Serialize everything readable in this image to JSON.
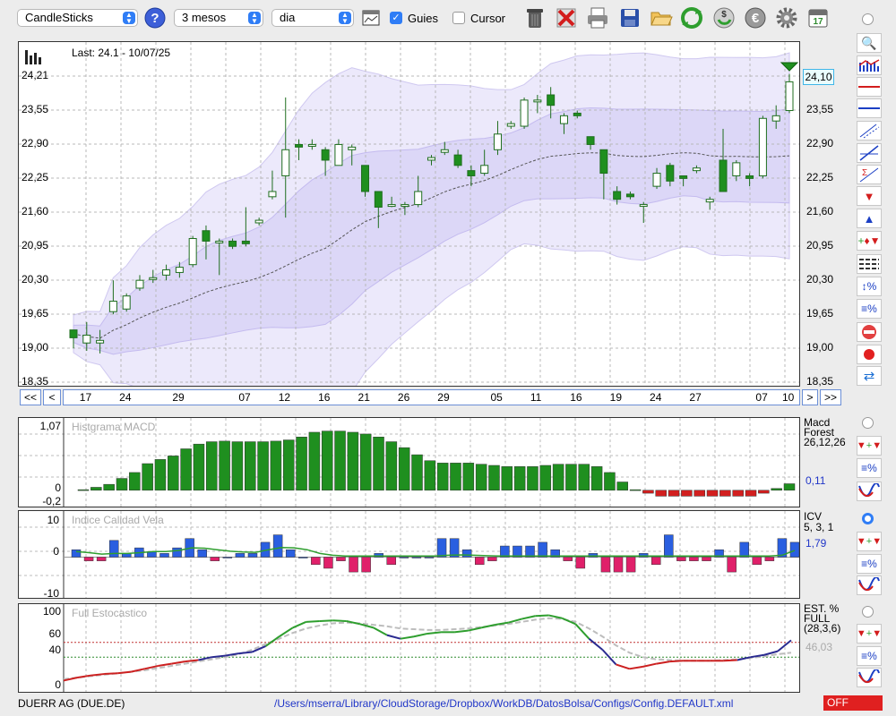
{
  "toolbar": {
    "chart_type": "CandleSticks",
    "period": "3 mesos",
    "interval": "dia",
    "guides_label": "Guies",
    "cursor_label": "Cursor",
    "guides_checked": true,
    "cursor_checked": false
  },
  "main": {
    "last_label": "Last: 24.1 - 10/07/25",
    "current_price": "24,10",
    "y_ticks": [
      "24,21",
      "23,55",
      "22,90",
      "22,25",
      "21,60",
      "20,95",
      "20,30",
      "19,65",
      "19,00",
      "18,35"
    ],
    "x_ticks": [
      "17",
      "24",
      "29",
      "07",
      "12",
      "16",
      "21",
      "26",
      "29",
      "05",
      "11",
      "16",
      "19",
      "24",
      "27",
      "07",
      "10"
    ],
    "nav": {
      "first": "<<",
      "prev": "<",
      "next": ">",
      "last": ">>"
    }
  },
  "macd": {
    "title": "Histgrama MACD",
    "name": "Macd",
    "name2": "Forest",
    "params": "26,12,26",
    "value": "0,11",
    "y_ticks": [
      "1,07",
      "0",
      "-0,2"
    ]
  },
  "icv": {
    "title": "Indice Calidad Vela",
    "name": "ICV",
    "params": "5, 3, 1",
    "value": "1,79",
    "y_ticks": [
      "10",
      "0",
      "-10"
    ]
  },
  "stoch": {
    "title": "Full Estocastico",
    "name": "EST. %",
    "name2": "FULL",
    "params": "(28,3,6)",
    "value": "46,03",
    "y_ticks": [
      "100",
      "60",
      "40",
      "0"
    ]
  },
  "status": {
    "instrument": "DUERR AG (DUE.DE)",
    "path": "/Users/mserra/Library/CloudStorage/Dropbox/WorkDB/DatosBolsa/Configs/Config.DEFAULT.xml",
    "off_label": "OFF"
  },
  "colors": {
    "up": "#ffffff",
    "down": "#1f8f1f",
    "macd_pos": "#1f8f1f",
    "macd_neg": "#d21f1f",
    "icv_pos": "#2a5fe0",
    "icv_neg": "#e0206a",
    "band": "#dcd7f7",
    "off": "#e02020"
  },
  "chart_data": [
    {
      "type": "candlestick",
      "ylim": [
        18.35,
        24.21
      ],
      "candles": [
        [
          19.35,
          19.2,
          19.35,
          19.0
        ],
        [
          19.1,
          19.25,
          19.5,
          18.95
        ],
        [
          19.1,
          19.15,
          19.35,
          18.9
        ],
        [
          19.7,
          19.9,
          20.3,
          19.65
        ],
        [
          19.75,
          20.0,
          20.05,
          19.7
        ],
        [
          20.15,
          20.3,
          20.4,
          20.1
        ],
        [
          20.35,
          20.35,
          20.5,
          20.25
        ],
        [
          20.4,
          20.5,
          20.6,
          20.3
        ],
        [
          20.45,
          20.55,
          20.65,
          20.35
        ],
        [
          20.6,
          21.1,
          21.15,
          20.55
        ],
        [
          21.25,
          21.05,
          21.35,
          20.7
        ],
        [
          21.05,
          21.05,
          21.1,
          20.4
        ],
        [
          21.05,
          20.95,
          21.1,
          20.9
        ],
        [
          21.05,
          21.0,
          21.7,
          20.95
        ],
        [
          21.4,
          21.45,
          21.5,
          21.35
        ],
        [
          21.9,
          22.0,
          22.4,
          21.85
        ],
        [
          22.3,
          22.8,
          23.8,
          21.5
        ],
        [
          22.9,
          22.85,
          23.0,
          22.6
        ],
        [
          22.9,
          22.9,
          23.0,
          22.8
        ],
        [
          22.8,
          22.6,
          22.85,
          22.3
        ],
        [
          22.5,
          22.9,
          23.0,
          22.5
        ],
        [
          22.8,
          22.85,
          22.9,
          22.5
        ],
        [
          22.5,
          22.0,
          22.5,
          21.9
        ],
        [
          22.0,
          21.7,
          22.0,
          21.3
        ],
        [
          21.75,
          21.75,
          21.9,
          21.7
        ],
        [
          21.75,
          21.75,
          21.8,
          21.55
        ],
        [
          21.75,
          22.0,
          22.3,
          21.7
        ],
        [
          22.6,
          22.65,
          22.7,
          22.5
        ],
        [
          22.75,
          22.8,
          22.95,
          22.7
        ],
        [
          22.7,
          22.5,
          22.8,
          22.45
        ],
        [
          22.4,
          22.3,
          22.5,
          22.1
        ],
        [
          22.35,
          22.5,
          22.8,
          22.3
        ],
        [
          22.8,
          23.1,
          23.35,
          22.7
        ],
        [
          23.25,
          23.3,
          23.35,
          23.2
        ],
        [
          23.25,
          23.75,
          23.8,
          23.2
        ],
        [
          23.75,
          23.75,
          23.85,
          23.5
        ],
        [
          23.85,
          23.65,
          24.0,
          23.4
        ],
        [
          23.3,
          23.45,
          23.5,
          23.1
        ],
        [
          23.5,
          23.45,
          23.55,
          23.4
        ],
        [
          23.05,
          22.9,
          23.05,
          22.8
        ],
        [
          22.8,
          22.35,
          22.8,
          21.85
        ],
        [
          22.0,
          21.85,
          22.1,
          21.75
        ],
        [
          21.95,
          21.9,
          22.0,
          21.85
        ],
        [
          21.75,
          21.75,
          21.8,
          21.4
        ],
        [
          22.1,
          22.35,
          22.45,
          22.05
        ],
        [
          22.5,
          22.2,
          22.55,
          22.1
        ],
        [
          22.3,
          22.25,
          22.3,
          22.1
        ],
        [
          22.4,
          22.45,
          22.5,
          22.35
        ],
        [
          21.8,
          21.85,
          21.9,
          21.65
        ],
        [
          22.6,
          22.0,
          23.2,
          22.0
        ],
        [
          22.3,
          22.55,
          22.6,
          22.2
        ],
        [
          22.3,
          22.25,
          22.35,
          22.1
        ],
        [
          22.3,
          23.4,
          23.45,
          22.25
        ],
        [
          23.35,
          23.45,
          23.65,
          23.2
        ],
        [
          23.55,
          24.1,
          24.25,
          23.5
        ]
      ]
    },
    {
      "type": "bar",
      "name": "MACD Forest",
      "ylim": [
        -0.2,
        1.07
      ],
      "values": [
        0.01,
        0.05,
        0.1,
        0.2,
        0.3,
        0.45,
        0.52,
        0.58,
        0.7,
        0.78,
        0.82,
        0.83,
        0.82,
        0.82,
        0.82,
        0.83,
        0.85,
        0.9,
        0.98,
        1.0,
        1.0,
        0.98,
        0.95,
        0.9,
        0.82,
        0.72,
        0.6,
        0.5,
        0.46,
        0.46,
        0.46,
        0.44,
        0.42,
        0.4,
        0.4,
        0.4,
        0.42,
        0.44,
        0.44,
        0.44,
        0.4,
        0.3,
        0.14,
        0.01,
        -0.05,
        -0.1,
        -0.1,
        -0.1,
        -0.1,
        -0.1,
        -0.1,
        -0.1,
        -0.1,
        -0.05,
        0.03,
        0.11
      ]
    },
    {
      "type": "bar",
      "name": "ICV",
      "ylim": [
        -10,
        10
      ],
      "values": [
        2,
        -1,
        -1,
        4.5,
        1,
        2.5,
        1.5,
        1,
        2.5,
        5,
        2,
        -1,
        0,
        1,
        1,
        4,
        6,
        2,
        0,
        -2,
        -3,
        -1,
        -4,
        -4,
        1,
        -2,
        0,
        0,
        0,
        5,
        5,
        2,
        -2,
        -1,
        3,
        3,
        3,
        4,
        2,
        -1,
        -3,
        1,
        -4,
        -4,
        -4,
        1,
        -2,
        6,
        -1,
        -1,
        -1,
        2,
        -4,
        4,
        -2,
        -1,
        5,
        4
      ],
      "line": [
        1.5,
        1.2,
        0.8,
        1,
        1,
        1.2,
        1.5,
        1.5,
        1.8,
        2.5,
        2.4,
        2,
        1.6,
        1.4,
        1.3,
        2,
        2.6,
        2.5,
        2,
        1,
        0.5,
        0.3,
        0.3,
        0.3,
        0.3,
        0.3,
        0.3,
        0.3,
        0.3,
        0.5,
        0.6,
        0.5,
        0.4,
        0.3,
        0.3,
        0.3,
        0.3,
        0.3,
        0.3,
        0.3,
        0.3,
        0.3,
        0.3,
        0.3,
        0.3,
        0.3,
        0.3,
        0.3,
        0.3,
        0.3,
        0.3,
        0.3,
        0.3,
        0.3,
        0.3,
        0.5,
        1.79
      ]
    },
    {
      "type": "line",
      "name": "Full Estocastico",
      "ylim": [
        0,
        100
      ],
      "levels": [
        60,
        40
      ],
      "k": [
        8,
        12,
        15,
        17,
        18,
        20,
        24,
        28,
        31,
        34,
        36,
        40,
        42,
        45,
        47,
        55,
        68,
        80,
        88,
        89,
        90,
        89,
        85,
        80,
        70,
        65,
        68,
        72,
        74,
        74,
        76,
        80,
        84,
        87,
        92,
        96,
        97,
        93,
        85,
        65,
        50,
        30,
        24,
        27,
        31,
        34,
        35,
        35,
        35,
        35,
        36,
        40,
        43,
        48,
        63
      ],
      "d": [
        10,
        12,
        14,
        16,
        18,
        20,
        22,
        25,
        28,
        31,
        34,
        37,
        40,
        44,
        50,
        58,
        65,
        73,
        79,
        83,
        86,
        87,
        86,
        84,
        82,
        79,
        78,
        77,
        77,
        78,
        79,
        81,
        83,
        85,
        88,
        91,
        93,
        92,
        88,
        79,
        68,
        56,
        46,
        40,
        37,
        36,
        35,
        35,
        35,
        36,
        37,
        39,
        41,
        44,
        46
      ]
    }
  ]
}
